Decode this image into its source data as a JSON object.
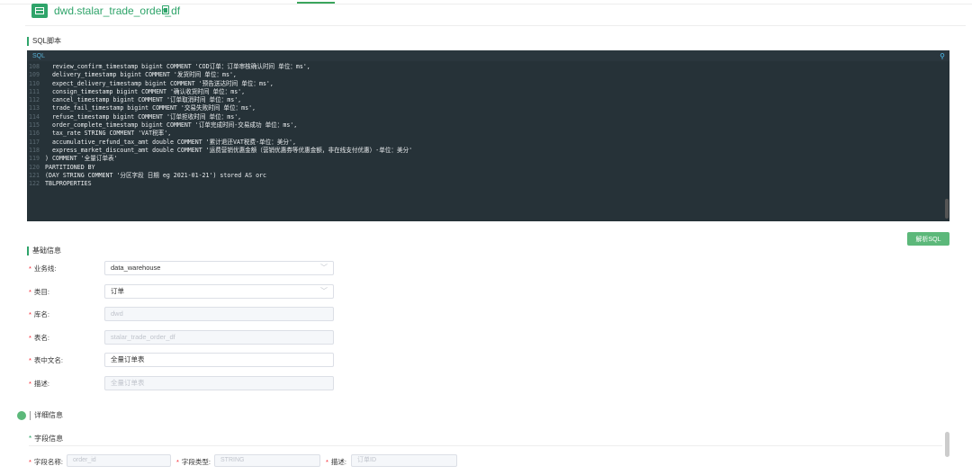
{
  "header": {
    "title": "dwd.stalar_trade_order_df"
  },
  "sql_section": {
    "heading": "SQL脚本",
    "editor_label": "SQL",
    "lines": [
      {
        "no": "108",
        "code": "  review_confirm_timestamp bigint COMMENT 'COD订单：订单审核确认时间 单位：ms',"
      },
      {
        "no": "109",
        "code": "  delivery_timestamp bigint COMMENT '发货时间 单位：ms',"
      },
      {
        "no": "110",
        "code": "  expect_delivery_timestamp bigint COMMENT '预告送达时间 单位：ms',"
      },
      {
        "no": "111",
        "code": "  consign_timestamp bigint COMMENT '确认收货时间 单位：ms',"
      },
      {
        "no": "112",
        "code": "  cancel_timestamp bigint COMMENT '订单取消时间 单位：ms',"
      },
      {
        "no": "113",
        "code": "  trade_fail_timestamp bigint COMMENT '交易失败时间 单位：ms',"
      },
      {
        "no": "114",
        "code": "  refuse_timestamp bigint COMMENT '订单拒收时间 单位：ms',"
      },
      {
        "no": "115",
        "code": "  order_complete_timestamp bigint COMMENT '订单完成时间-交易成功 单位：ms',"
      },
      {
        "no": "116",
        "code": "  tax_rate STRING COMMENT 'VAT税率',"
      },
      {
        "no": "117",
        "code": "  accumulative_refund_tax_amt double COMMENT '累计退还VAT税费-单位：美分',"
      },
      {
        "no": "118",
        "code": "  express_market_discount_amt double COMMENT '运费营销优惠金额（营销优惠券等优惠金额，非在线支付优惠）-单位：美分'"
      },
      {
        "no": "119",
        "code": ") COMMENT '全量订单表'"
      },
      {
        "no": "120",
        "code": "PARTITIONED BY"
      },
      {
        "no": "121",
        "code": "(DAY STRING COMMENT '分区字段 日期 eg 2021-01-21') stored AS orc"
      },
      {
        "no": "122",
        "code": "TBLPROPERTIES"
      }
    ],
    "parse_button": "解析SQL"
  },
  "basic_info": {
    "heading": "基础信息",
    "fields": [
      {
        "label": "业务线:",
        "value": "data_warehouse",
        "kind": "select",
        "required": true
      },
      {
        "label": "类目:",
        "value": "订单",
        "kind": "select",
        "required": true
      },
      {
        "label": "库名:",
        "value": "dwd",
        "kind": "disabled",
        "required": true
      },
      {
        "label": "表名:",
        "value": "stalar_trade_order_df",
        "kind": "disabled",
        "required": true
      },
      {
        "label": "表中文名:",
        "value": "全量订单表",
        "kind": "text",
        "required": true
      },
      {
        "label": "描述:",
        "value": "全量订单表",
        "kind": "disabled",
        "required": true
      }
    ]
  },
  "detail_info": {
    "heading": "详细信息",
    "field_info_heading": "字段信息",
    "field_name_label": "字段名称:",
    "field_name_value": "order_id",
    "field_type_label": "字段类型:",
    "field_type_value": "STRING",
    "desc_label": "描述:",
    "desc_value": "订单ID"
  },
  "colors": {
    "accent": "#2fa46a",
    "button": "#5cb87a",
    "editor_bg": "#263238"
  }
}
